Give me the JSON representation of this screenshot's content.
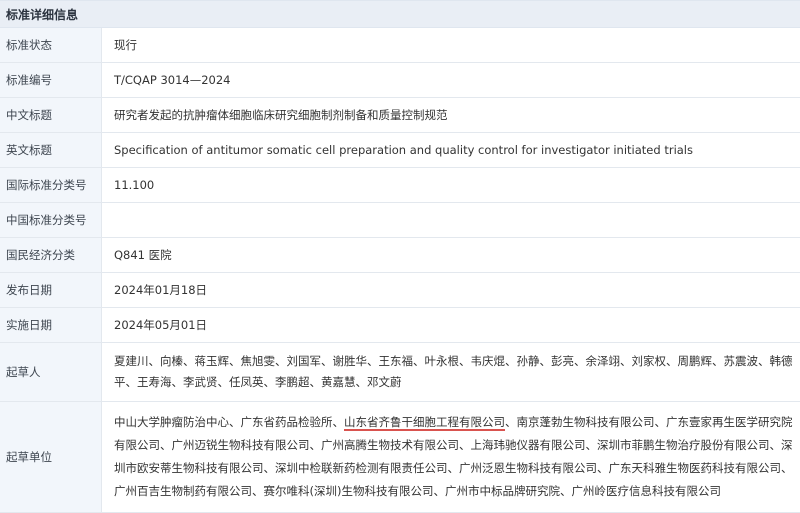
{
  "section_title": "标准详细信息",
  "rows": [
    {
      "label": "标准状态",
      "value": "现行"
    },
    {
      "label": "标准编号",
      "value": "T/CQAP 3014—2024"
    },
    {
      "label": "中文标题",
      "value": "研究者发起的抗肿瘤体细胞临床研究细胞制剂制备和质量控制规范"
    },
    {
      "label": "英文标题",
      "value": "Specification of antitumor somatic cell preparation and quality control for investigator initiated trials"
    },
    {
      "label": "国际标准分类号",
      "value": "11.100"
    },
    {
      "label": "中国标准分类号",
      "value": ""
    },
    {
      "label": "国民经济分类",
      "value": "Q841 医院"
    },
    {
      "label": "发布日期",
      "value": "2024年01月18日"
    },
    {
      "label": "实施日期",
      "value": "2024年05月01日"
    }
  ],
  "drafters": {
    "label": "起草人",
    "value": "夏建川、向榛、蒋玉辉、焦旭雯、刘国军、谢胜华、王东福、叶永根、韦庆焜、孙静、彭亮、余泽翊、刘家权、周鹏辉、苏震波、韩德平、王寿海、李武贤、任凤英、李鹏超、黄嘉慧、邓文蔚"
  },
  "units": {
    "label": "起草单位",
    "before": "中山大学肿瘤防治中心、广东省药品检验所、",
    "highlight": "山东省齐鲁干细胞工程有限公司",
    "after": "、南京蓬勃生物科技有限公司、广东壹家再生医学研究院有限公司、广州迈锐生物科技有限公司、广州高腾生物技术有限公司、上海玮驰仪器有限公司、深圳市菲鹏生物治疗股份有限公司、深圳市欧安蒂生物科技有限公司、深圳中检联新药检测有限责任公司、广州泛恩生物科技有限公司、广东天科雅生物医药科技有限公司、广州百吉生物制药有限公司、赛尔唯科(深圳)生物科技有限公司、广州市中标品牌研究院、广州岭医疗信息科技有限公司"
  }
}
